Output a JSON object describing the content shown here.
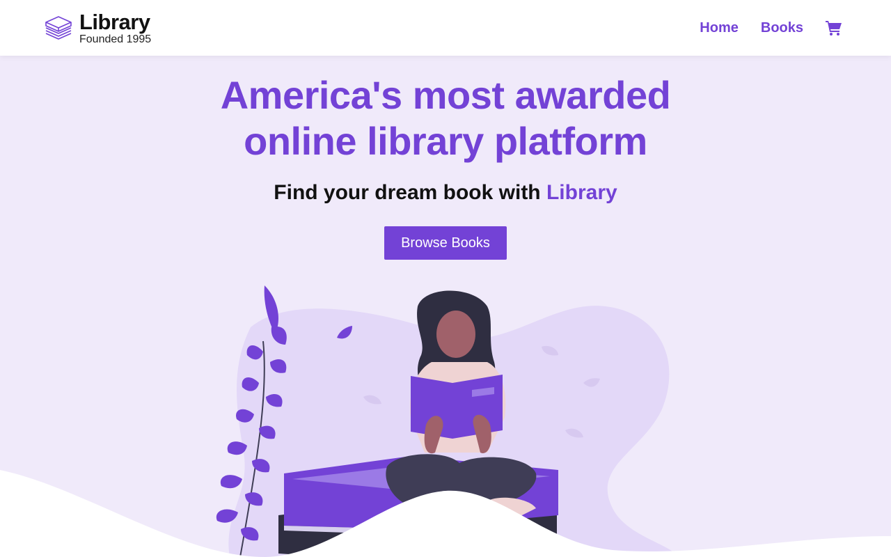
{
  "brand": {
    "title": "Library",
    "subtitle": "Founded 1995",
    "icon": "books-stack-icon"
  },
  "nav": {
    "links": [
      {
        "label": "Home"
      },
      {
        "label": "Books"
      }
    ],
    "cart_icon": "shopping-cart-icon"
  },
  "hero": {
    "title_line1": "America's most awarded",
    "title_line2": "online library platform",
    "subtitle_prefix": "Find your dream book with",
    "subtitle_accent": "Library",
    "button_label": "Browse Books"
  },
  "colors": {
    "accent": "#7342d6",
    "background": "#f0eafa",
    "blob": "#e3d8f8"
  }
}
